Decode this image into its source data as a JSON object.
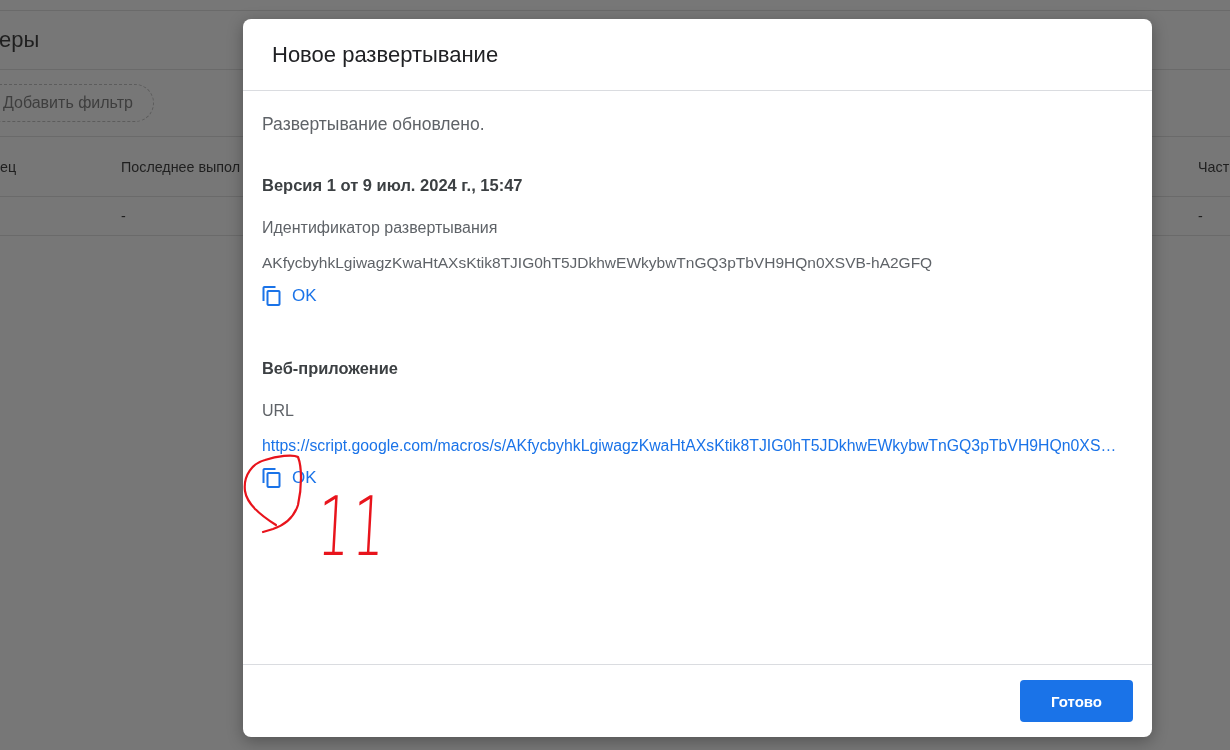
{
  "background_page": {
    "title": "еры",
    "filter_chip": "Добавить фильтр",
    "table": {
      "columns": [
        {
          "label": "ец"
        },
        {
          "label": "Последнее выпол",
          "values": [
            "-"
          ]
        },
        {
          "label": "Част",
          "values": [
            "-"
          ]
        }
      ]
    }
  },
  "dialog": {
    "title": "Новое развертывание",
    "message": "Развертывание обновлено.",
    "version": "Версия 1 от 9 июл. 2024 г., 15:47",
    "deployment_id": {
      "label": "Идентификатор развертывания",
      "value": "AKfycbyhkLgiwagzKwaHtAXsKtik8TJIG0hT5JDkhwEWkybwTnGQ3pTbVH9HQn0XSVB-hA2GFQ",
      "copy_button": "OK"
    },
    "web_app": {
      "heading": "Веб-приложение",
      "label": "URL",
      "link": "https://script.google.com/macros/s/AKfycbyhkLgiwagzKwaHtAXsKtik8TJIG0hT5JDkhwEWkybwTnGQ3pTbVH9HQn0XS…",
      "copy_button": "OK"
    },
    "done_button": "Готово"
  },
  "annotation": {
    "text": "11"
  }
}
